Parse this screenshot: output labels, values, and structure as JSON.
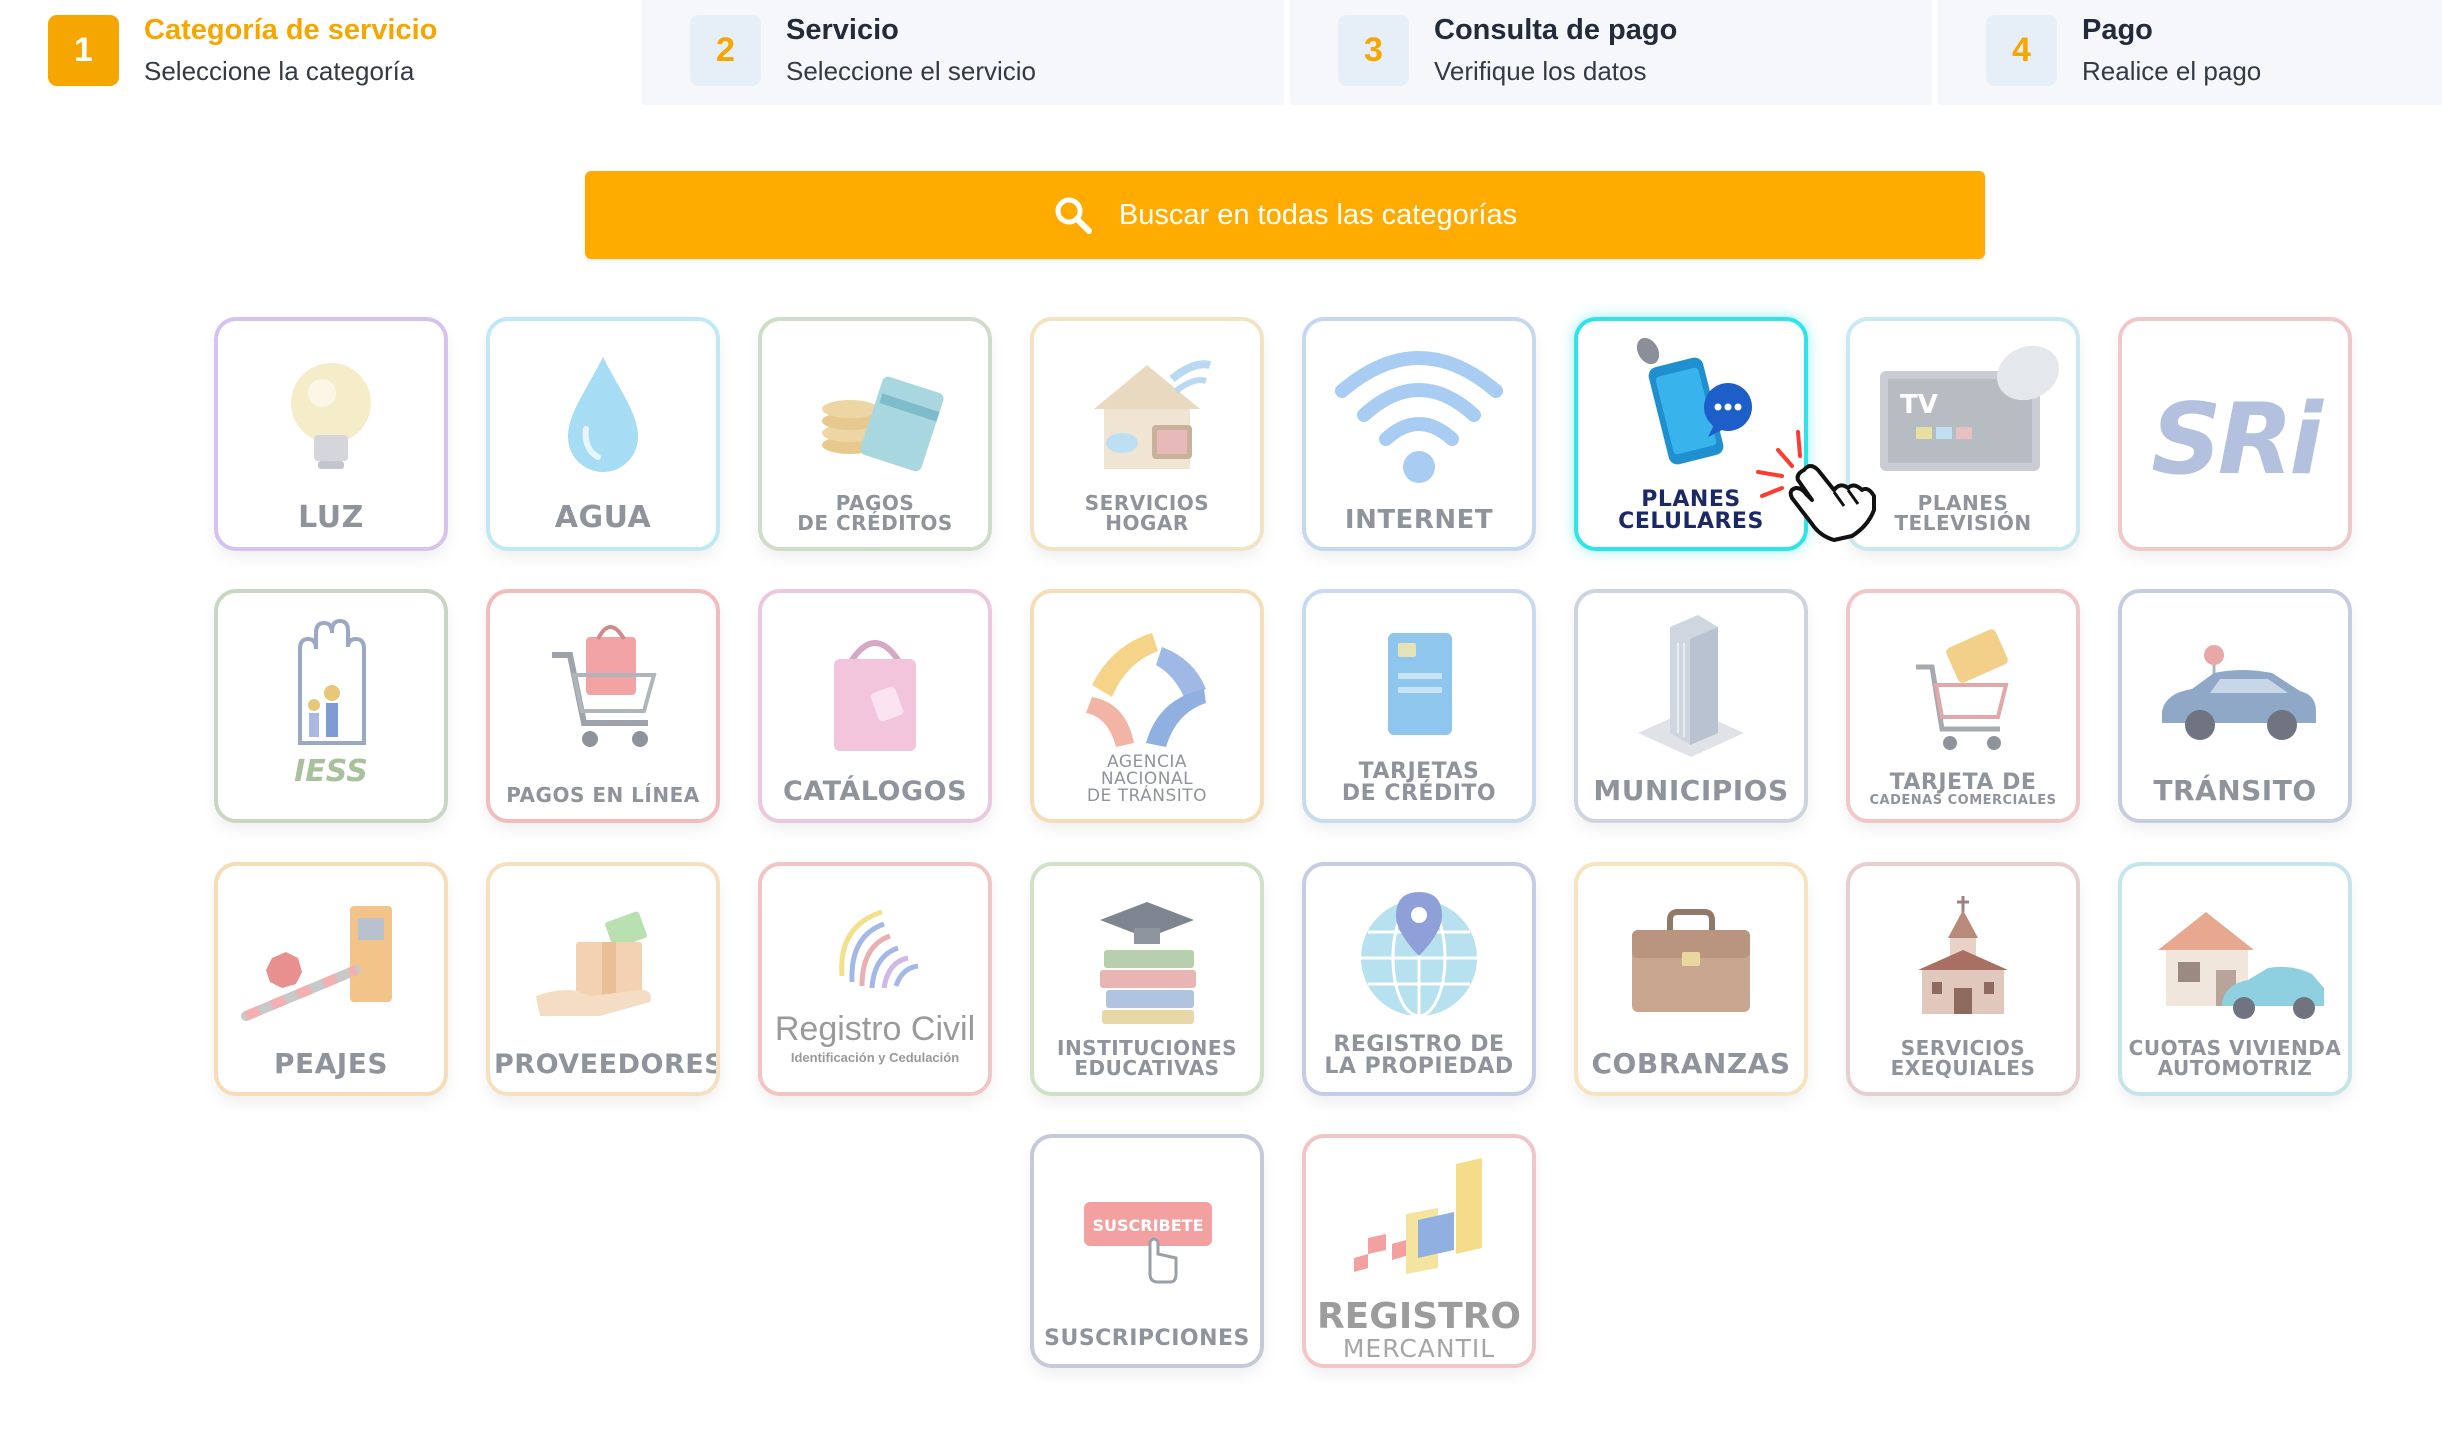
{
  "steps": [
    {
      "number": "1",
      "title": "Categoría de servicio",
      "subtitle": "Seleccione la categoría",
      "active": true
    },
    {
      "number": "2",
      "title": "Servicio",
      "subtitle": "Seleccione el servicio",
      "active": false
    },
    {
      "number": "3",
      "title": "Consulta de pago",
      "subtitle": "Verifique los datos",
      "active": false
    },
    {
      "number": "4",
      "title": "Pago",
      "subtitle": "Realice el pago",
      "active": false
    }
  ],
  "search": {
    "label": "Buscar en todas las categorías",
    "icon": "search-icon",
    "color": "#ffab00"
  },
  "colors": {
    "accent": "#f6a600",
    "highlight_border": "#2de4ea",
    "highlight_label": "#1b2a66"
  },
  "categories": [
    {
      "label": [
        "LUZ"
      ],
      "icon": "light-bulb-icon",
      "border": "#d7c2ef"
    },
    {
      "label": [
        "AGUA"
      ],
      "icon": "water-drop-icon",
      "border": "#bfe9f5"
    },
    {
      "label": [
        "PAGOS",
        "DE CRÉDITOS"
      ],
      "icon": "coins-card-icon",
      "border": "#cfdcc7"
    },
    {
      "label": [
        "SERVICIOS",
        "HOGAR"
      ],
      "icon": "house-services-icon",
      "border": "#f2e3c4"
    },
    {
      "label": [
        "INTERNET"
      ],
      "icon": "wifi-icon",
      "border": "#c5d8f0"
    },
    {
      "label": [
        "PLANES",
        "CELULARES"
      ],
      "icon": "smartphone-chat-icon",
      "border": "#2de4ea",
      "highlighted": true
    },
    {
      "label": [
        "PLANES",
        "TELEVISIÓN"
      ],
      "icon": "tv-satellite-icon",
      "border": "#c8e8f2"
    },
    {
      "label": [],
      "logo_text": "SRi",
      "icon": "sri-logo-icon",
      "border": "#f0c8c8"
    },
    {
      "label": [],
      "logo_text": "IESS",
      "icon": "iess-logo-icon",
      "border": "#c9d6c2"
    },
    {
      "label": [
        "PAGOS EN LÍNEA"
      ],
      "icon": "shopping-cart-icon",
      "border": "#f2bcbc"
    },
    {
      "label": [
        "CATÁLOGOS"
      ],
      "icon": "shopping-bag-icon",
      "border": "#ecc7e0"
    },
    {
      "label": [
        "AGENCIA",
        "NACIONAL",
        "DE TRÁNSITO"
      ],
      "icon": "ant-logo-icon",
      "border": "#f5ddb8"
    },
    {
      "label": [
        "TARJETAS",
        "DE CRÉDITO"
      ],
      "icon": "credit-card-icon",
      "border": "#c8daf0"
    },
    {
      "label": [
        "MUNICIPIOS"
      ],
      "icon": "building-icon",
      "border": "#cdd4e0"
    },
    {
      "label": [
        "TARJETA DE",
        "CADENAS COMERCIALES"
      ],
      "icon": "cart-card-icon",
      "border": "#f2c6c6"
    },
    {
      "label": [
        "TRÁNSITO"
      ],
      "icon": "taxi-car-icon",
      "border": "#c7cde0"
    },
    {
      "label": [
        "PEAJES"
      ],
      "icon": "toll-barrier-icon",
      "border": "#f7dcb8"
    },
    {
      "label": [
        "PROVEEDORES"
      ],
      "icon": "package-hand-icon",
      "border": "#f7e0c0"
    },
    {
      "label": [],
      "logo_text": "Registro Civil",
      "logo_sub": "Identificación y Cedulación",
      "icon": "fingerprint-icon",
      "border": "#f2c4c4"
    },
    {
      "label": [
        "INSTITUCIONES",
        "EDUCATIVAS"
      ],
      "icon": "graduation-books-icon",
      "border": "#cfe2c8"
    },
    {
      "label": [
        "REGISTRO DE",
        "LA PROPIEDAD"
      ],
      "icon": "globe-pin-icon",
      "border": "#c6cbe6"
    },
    {
      "label": [
        "COBRANZAS"
      ],
      "icon": "briefcase-icon",
      "border": "#f7e3bd"
    },
    {
      "label": [
        "SERVICIOS",
        "EXEQUIALES"
      ],
      "icon": "church-icon",
      "border": "#e8cfcf"
    },
    {
      "label": [
        "CUOTAS VIVIENDA",
        "AUTOMOTRIZ"
      ],
      "icon": "house-car-icon",
      "border": "#c4e5ea"
    },
    {
      "label": [
        "SUSCRIPCIONES"
      ],
      "badge": "SUSCRIBETE",
      "icon": "subscribe-button-icon",
      "border": "#c4cad8"
    },
    {
      "label": [],
      "logo_text": "REGISTRO",
      "logo_sub": "MERCANTIL",
      "icon": "registro-mercantil-logo-icon",
      "border": "#f2c6c6"
    }
  ],
  "pointer": {
    "icon": "hand-pointer-icon"
  }
}
